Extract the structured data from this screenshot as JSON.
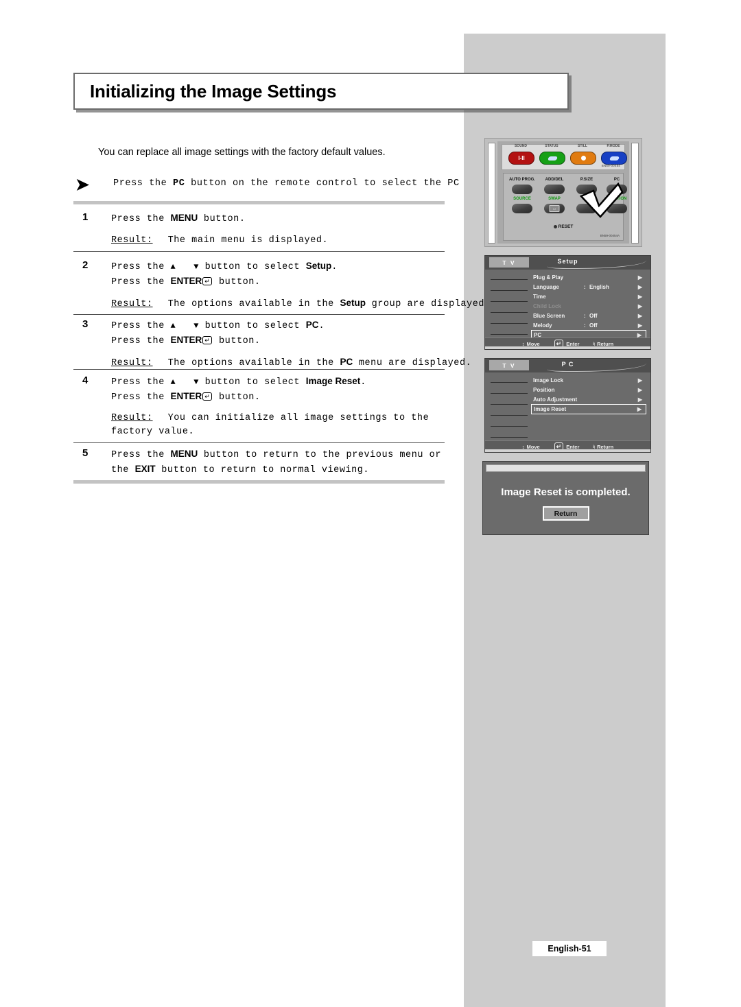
{
  "page": {
    "title": "Initializing the Image Settings",
    "intro": "You can replace all image settings with the factory default values.",
    "footer_label": "English-51"
  },
  "note": {
    "arrow_icon": "triangle-right-arrow-icon",
    "text_prefix": "Press the ",
    "bold_key": "PC",
    "text_suffix": " button on the remote control to select the PC mode."
  },
  "steps": [
    {
      "number": "1",
      "line1_prefix": "Press the ",
      "line1_key": "MENU",
      "line1_suffix": " button.",
      "result_label": "Result:",
      "result_text": "The main menu is displayed."
    },
    {
      "number": "2",
      "line1_prefix": "Press the ",
      "line1_up": "▲",
      "line1_down": "▼",
      "line1_mid": " button to select ",
      "line1_key": "Setup",
      "line1_suffix": ".",
      "line2_prefix": "Press the ",
      "line2_key": "ENTER",
      "line2_kbd": "↵",
      "line2_suffix": " button.",
      "result_label": "Result:",
      "result_text_a": "The options available in the ",
      "result_key": "Setup",
      "result_text_b": " group are displayed."
    },
    {
      "number": "3",
      "line1_prefix": "Press the ",
      "line1_up": "▲",
      "line1_down": "▼",
      "line1_mid": " button to select ",
      "line1_key": "PC",
      "line1_suffix": ".",
      "line2_prefix": "Press the ",
      "line2_key": "ENTER",
      "line2_kbd": "↵",
      "line2_suffix": " button.",
      "result_label": "Result:",
      "result_text_a": "The options available in the ",
      "result_key": "PC",
      "result_text_b": " menu are displayed."
    },
    {
      "number": "4",
      "line1_prefix": "Press the ",
      "line1_up": "▲",
      "line1_down": "▼",
      "line1_mid": " button to select ",
      "line1_key": "Image Reset",
      "line1_suffix": ".",
      "line2_prefix": "Press the ",
      "line2_key": "ENTER",
      "line2_kbd": "↵",
      "line2_suffix": " button.",
      "result_label": "Result:",
      "result_text_a": "You can initialize all image settings to the factory value."
    },
    {
      "number": "5",
      "line1_prefix": "Press the ",
      "line1_key": "MENU",
      "line1_suffix": " button to return to the previous menu or",
      "line2_prefix": "the ",
      "line2_key": "EXIT",
      "line2_suffix": " button to return to normal viewing."
    }
  ],
  "remote": {
    "color_buttons": [
      {
        "tag": "SOUND",
        "label": "I-II",
        "color": "#b31212"
      },
      {
        "tag": "STATUS",
        "label": "",
        "color": "#16a016"
      },
      {
        "tag": "STILL",
        "label": "",
        "color": "#e07b10"
      },
      {
        "tag": "P.MODE",
        "label": "",
        "color": "#1740c4"
      }
    ],
    "model_code_top": "BN59-00454",
    "keypad_labels_top": [
      "AUTO PROG.",
      "ADD/DEL",
      "P.SIZE",
      "PC"
    ],
    "keypad_labels_green": [
      "SOURCE",
      "SWAP",
      "",
      "POSITION"
    ],
    "reset_label": "RESET",
    "model_code_bottom": "BN59-00454A",
    "pointer_icon": "checkmark-pointer-icon"
  },
  "osd_setup": {
    "tab_label": "T V",
    "title": "Setup",
    "rows": [
      {
        "name": "Plug & Play",
        "colon": "",
        "value": "",
        "dim": false,
        "selected": false
      },
      {
        "name": "Language",
        "colon": ":",
        "value": "English",
        "dim": false,
        "selected": false
      },
      {
        "name": "Time",
        "colon": "",
        "value": "",
        "dim": false,
        "selected": false
      },
      {
        "name": "Child Lock",
        "colon": "",
        "value": "",
        "dim": true,
        "selected": false
      },
      {
        "name": "Blue Screen",
        "colon": ":",
        "value": "Off",
        "dim": false,
        "selected": false
      },
      {
        "name": "Melody",
        "colon": ":",
        "value": "Off",
        "dim": false,
        "selected": false
      },
      {
        "name": "PC",
        "colon": "",
        "value": "",
        "dim": false,
        "selected": true
      }
    ],
    "footer": {
      "move": "Move",
      "enter": "Enter",
      "return": "Return"
    }
  },
  "osd_pc": {
    "tab_label": "T V",
    "title": "P C",
    "rows": [
      {
        "name": "Image Lock",
        "colon": "",
        "value": "",
        "dim": false,
        "selected": false
      },
      {
        "name": "Position",
        "colon": "",
        "value": "",
        "dim": false,
        "selected": false
      },
      {
        "name": "Auto Adjustment",
        "colon": "",
        "value": "",
        "dim": false,
        "selected": false
      },
      {
        "name": "Image Reset",
        "colon": "",
        "value": "",
        "dim": false,
        "selected": true
      }
    ],
    "footer": {
      "move": "Move",
      "enter": "Enter",
      "return": "Return"
    }
  },
  "dialog": {
    "message": "Image Reset is completed.",
    "button_label": "Return"
  }
}
